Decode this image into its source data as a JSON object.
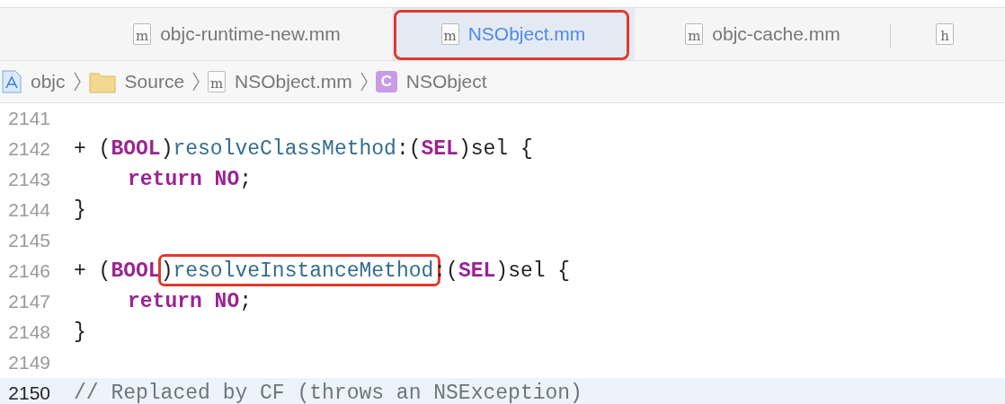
{
  "tabs": [
    {
      "icon_letter": "m",
      "label": "objc-runtime-new.mm",
      "selected": false,
      "annotated": false
    },
    {
      "icon_letter": "m",
      "label": "NSObject.mm",
      "selected": true,
      "annotated": true
    },
    {
      "icon_letter": "m",
      "label": "objc-cache.mm",
      "selected": false,
      "annotated": false
    },
    {
      "icon_letter": "h",
      "selected": false,
      "annotated": false
    }
  ],
  "breadcrumb": [
    {
      "kind": "project",
      "label": "objc"
    },
    {
      "kind": "folder",
      "label": "Source"
    },
    {
      "kind": "file",
      "icon_letter": "m",
      "label": "NSObject.mm"
    },
    {
      "kind": "class",
      "icon_letter": "C",
      "label": "NSObject"
    }
  ],
  "code": [
    {
      "number": "2141",
      "current": false
    },
    {
      "number": "2142",
      "current": false,
      "tokens": [
        {
          "kind": "plain",
          "text": "+ ("
        },
        {
          "kind": "keyword",
          "text": "BOOL"
        },
        {
          "kind": "plain",
          "text": ")"
        },
        {
          "kind": "method",
          "text": "resolveClassMethod"
        },
        {
          "kind": "plain",
          "text": ":("
        },
        {
          "kind": "keyword",
          "text": "SEL"
        },
        {
          "kind": "plain",
          "text": ")sel {"
        }
      ]
    },
    {
      "number": "2143",
      "current": false,
      "indented": true,
      "tokens": [
        {
          "kind": "keyword",
          "text": "return NO"
        },
        {
          "kind": "plain",
          "text": ";"
        }
      ]
    },
    {
      "number": "2144",
      "current": false,
      "tokens": [
        {
          "kind": "plain",
          "text": "}"
        }
      ]
    },
    {
      "number": "2145",
      "current": false
    },
    {
      "number": "2146",
      "current": false,
      "tokens": [
        {
          "kind": "plain",
          "text": "+ ("
        },
        {
          "kind": "keyword",
          "text": "BOOL"
        },
        {
          "kind": "plain",
          "text": ")"
        },
        {
          "kind": "method",
          "text": "resolveInstanceMethod",
          "annotated": true
        },
        {
          "kind": "plain",
          "text": ":("
        },
        {
          "kind": "keyword",
          "text": "SEL"
        },
        {
          "kind": "plain",
          "text": ")sel {"
        }
      ]
    },
    {
      "number": "2147",
      "current": false,
      "indented": true,
      "tokens": [
        {
          "kind": "keyword",
          "text": "return NO"
        },
        {
          "kind": "plain",
          "text": ";"
        }
      ]
    },
    {
      "number": "2148",
      "current": false,
      "tokens": [
        {
          "kind": "plain",
          "text": "}"
        }
      ]
    },
    {
      "number": "2149",
      "current": false
    },
    {
      "number": "2150",
      "current": true,
      "tokens": [
        {
          "kind": "comment",
          "text": "// Replaced by CF (throws an NSException)"
        }
      ]
    }
  ]
}
